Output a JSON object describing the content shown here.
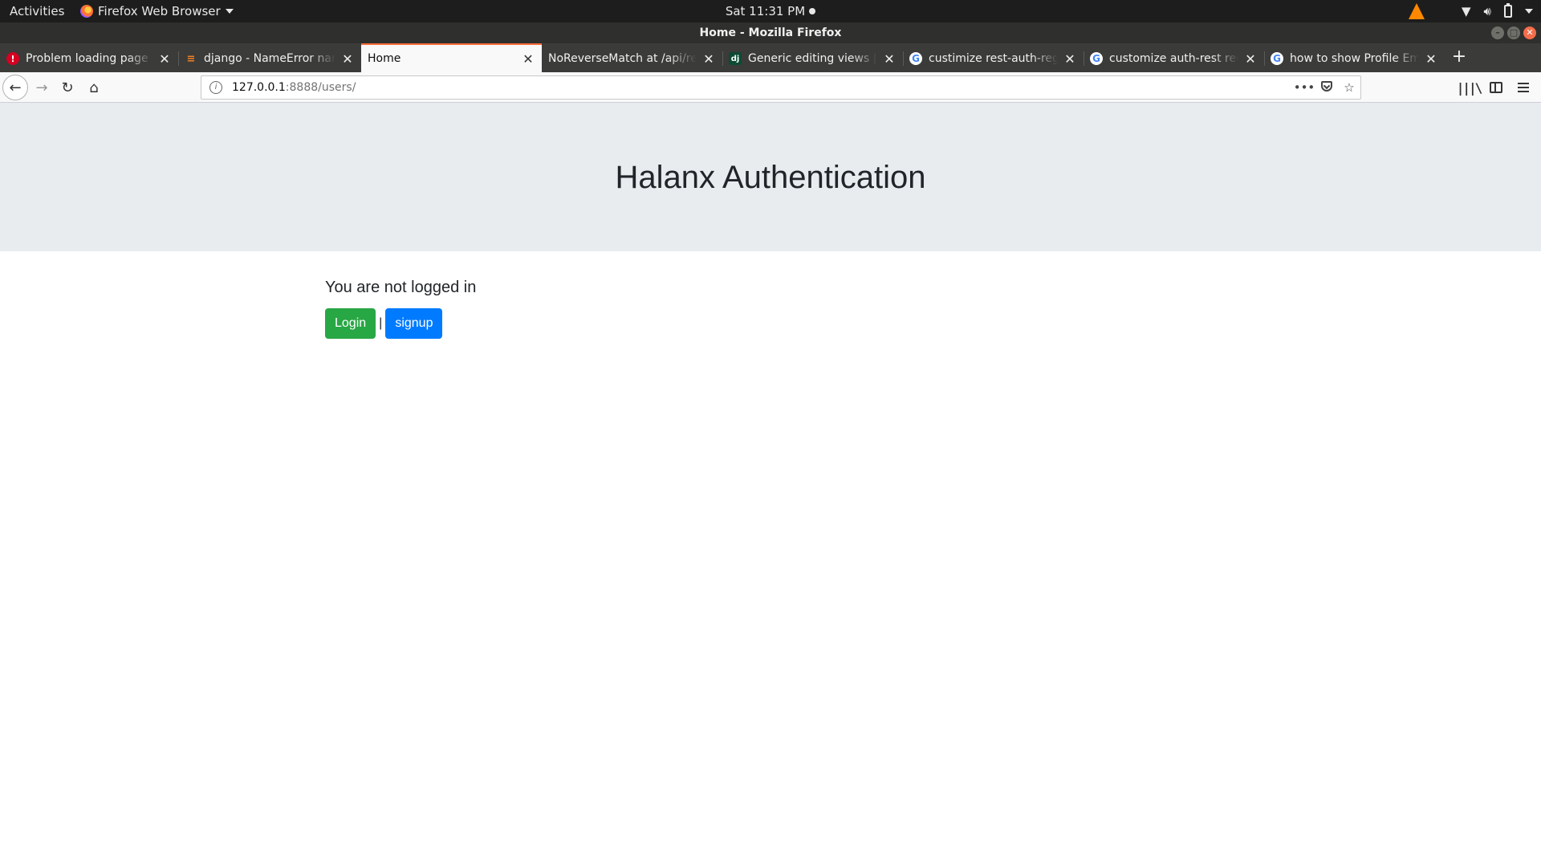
{
  "system": {
    "activities": "Activities",
    "app_menu": "Firefox Web Browser",
    "clock": "Sat 11:31 PM"
  },
  "window": {
    "title": "Home - Mozilla Firefox"
  },
  "tabs": [
    {
      "title": "Problem loading page",
      "favicon": "error-icon",
      "active": false
    },
    {
      "title": "django - NameError name",
      "favicon": "stackoverflow-icon",
      "active": false
    },
    {
      "title": "Home",
      "favicon": "none",
      "active": true
    },
    {
      "title": "NoReverseMatch at /api/re",
      "favicon": "none",
      "active": false
    },
    {
      "title": "Generic editing views | D",
      "favicon": "django-icon",
      "active": false
    },
    {
      "title": "custimize rest-auth-regis",
      "favicon": "google-icon",
      "active": false
    },
    {
      "title": "customize auth-rest regi",
      "favicon": "google-icon",
      "active": false
    },
    {
      "title": "how to show Profile Ema",
      "favicon": "google-icon",
      "active": false
    }
  ],
  "urlbar": {
    "host": "127.0.0.1",
    "path": ":8888/users/"
  },
  "page": {
    "heading": "Halanx Authentication",
    "status": "You are not logged in",
    "login_label": "Login",
    "separator": "|",
    "signup_label": "signup"
  },
  "colors": {
    "login_button": "#28a745",
    "signup_button": "#007bff",
    "jumbotron_bg": "#e9ecef",
    "active_tab_accent": "#ff6d3a"
  }
}
